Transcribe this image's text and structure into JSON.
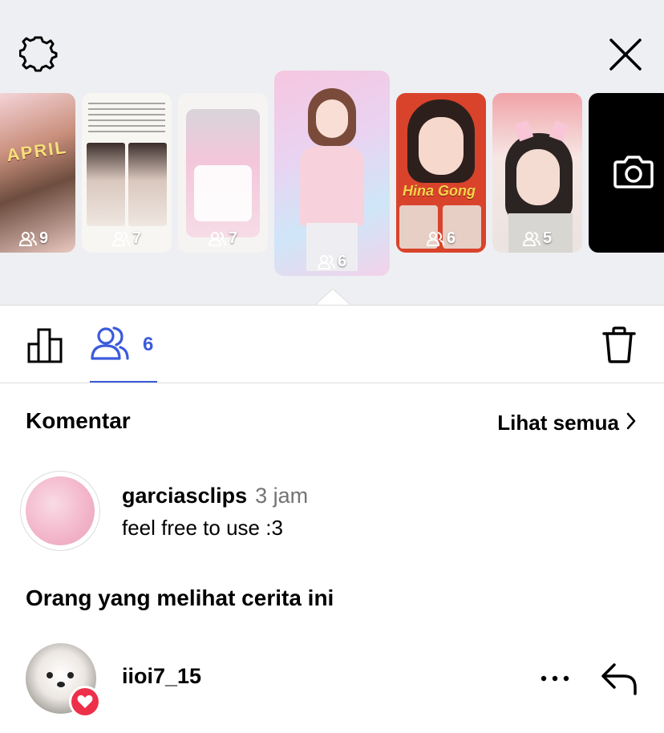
{
  "stories": [
    {
      "views": "9"
    },
    {
      "views": "7"
    },
    {
      "views": "7"
    },
    {
      "views": "6"
    },
    {
      "views": "6"
    },
    {
      "views": "5"
    }
  ],
  "thumb_texts": {
    "april_word": "APRIL",
    "hina_word": "Hina Gong"
  },
  "stats_bar": {
    "viewers_count": "6"
  },
  "comments": {
    "title": "Komentar",
    "see_all": "Lihat semua",
    "items": [
      {
        "username": "garciasclips",
        "time": "3 jam",
        "text": "feel free to use :3"
      }
    ]
  },
  "viewers": {
    "title": "Orang yang melihat cerita ini",
    "items": [
      {
        "username": "iioi7_15"
      }
    ]
  },
  "colors": {
    "accent": "#3b5bdb",
    "top_bg": "#eeeff2",
    "heart_badge": "#ed2f4a"
  }
}
